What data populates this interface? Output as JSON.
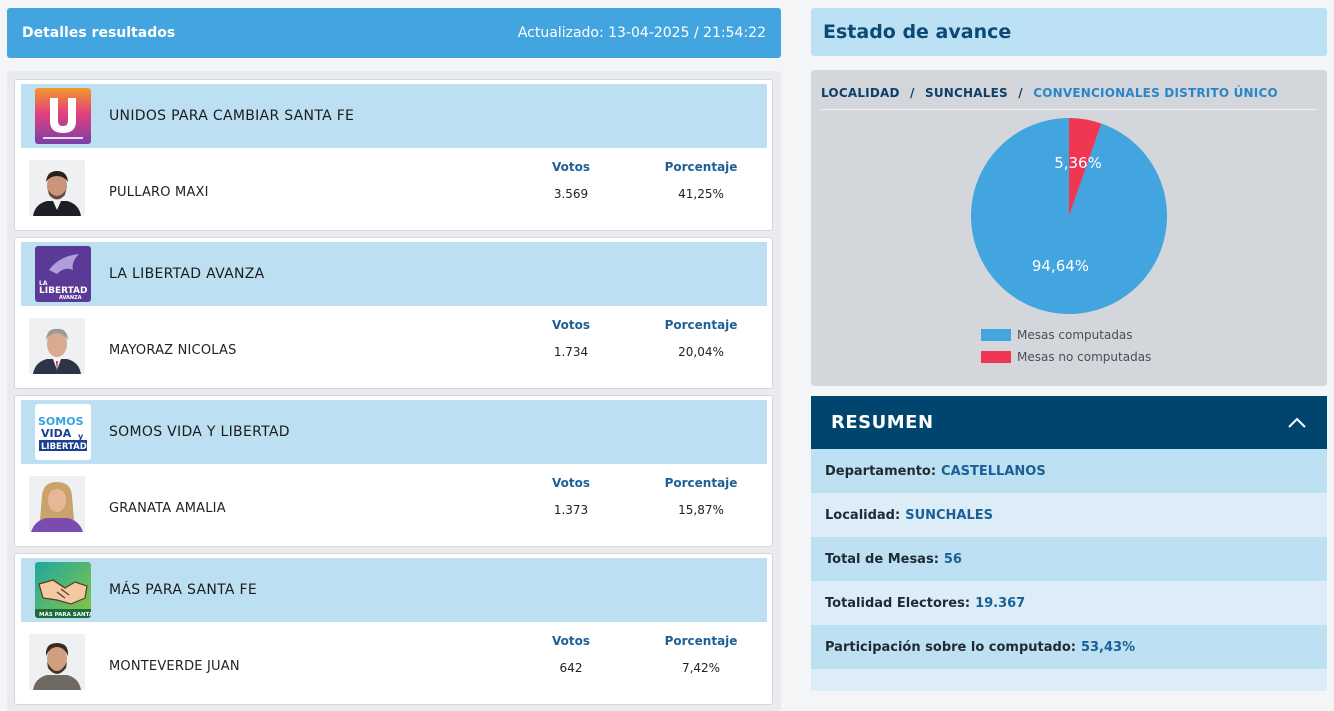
{
  "results": {
    "title": "Detalles resultados",
    "updated": "Actualizado: 13-04-2025 / 21:54:22",
    "votos_label": "Votos",
    "porcentaje_label": "Porcentaje",
    "parties": [
      {
        "name": "UNIDOS PARA CAMBIAR SANTA FE",
        "logo_text": "U",
        "logo_subtext": "UNIDOS PARA CAMBIAR SANTA FE",
        "candidate": "PULLARO MAXI",
        "votos": "3.569",
        "porcentaje": "41,25%"
      },
      {
        "name": "LA LIBERTAD AVANZA",
        "logo_text": "LA LIBERTAD",
        "logo_subtext": "AVANZA",
        "candidate": "MAYORAZ NICOLAS",
        "votos": "1.734",
        "porcentaje": "20,04%"
      },
      {
        "name": "SOMOS VIDA Y LIBERTAD",
        "logo_text": "SOMOS VIDA",
        "logo_subtext": "LIBERTAD",
        "candidate": "GRANATA AMALIA",
        "votos": "1.373",
        "porcentaje": "15,87%"
      },
      {
        "name": "MÁS PARA SANTA FE",
        "logo_text": "MÁS PARA SANTA FE",
        "logo_subtext": "",
        "candidate": "MONTEVERDE JUAN",
        "votos": "642",
        "porcentaje": "7,42%"
      }
    ]
  },
  "estado": {
    "title": "Estado de avance",
    "breadcrumb": [
      "LOCALIDAD",
      "SUNCHALES",
      "CONVENCIONALES DISTRITO ÚNICO"
    ],
    "separator": "/",
    "legend_computadas": "Mesas computadas",
    "legend_no_computadas": "Mesas no computadas",
    "colors": {
      "computadas": "#42a5df",
      "no_computadas": "#ef3653"
    }
  },
  "chart_data": {
    "type": "pie",
    "categories": [
      "Mesas computadas",
      "Mesas no computadas"
    ],
    "values": [
      94.64,
      5.36
    ],
    "labels": [
      "94,64%",
      "5,36%"
    ],
    "legend": "bottom"
  },
  "resumen": {
    "title": "RESUMEN",
    "rows": [
      {
        "label": "Departamento:",
        "value": "CASTELLANOS"
      },
      {
        "label": "Localidad:",
        "value": "SUNCHALES"
      },
      {
        "label": "Total de Mesas:",
        "value": "56"
      },
      {
        "label": "Totalidad Electores:",
        "value": "19.367"
      },
      {
        "label": "Participación sobre lo computado:",
        "value": "53,43%"
      }
    ]
  }
}
